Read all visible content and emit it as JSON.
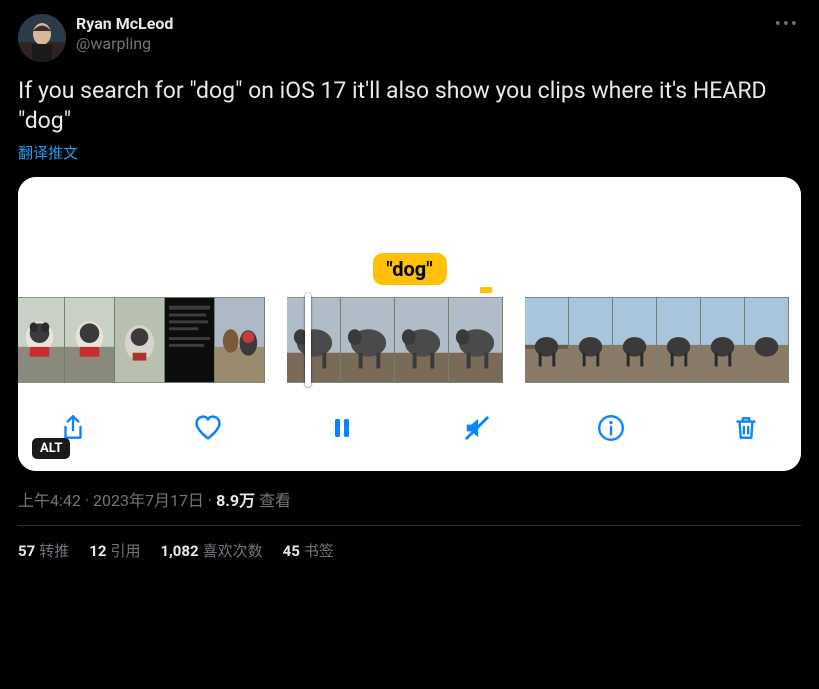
{
  "author": {
    "display_name": "Ryan McLeod",
    "handle": "@warpling"
  },
  "tweet": {
    "text": "If you search for \"dog\" on iOS 17 it'll also show you clips where it's HEARD \"dog\"",
    "translate_label": "翻译推文"
  },
  "media": {
    "search_term": "\"dog\"",
    "alt_badge": "ALT",
    "toolbar": {
      "share": "share",
      "like": "like",
      "pause": "pause",
      "mute": "mute",
      "info": "info",
      "delete": "delete"
    }
  },
  "meta": {
    "time": "上午4:42",
    "date": "2023年7月17日",
    "views_count": "8.9万",
    "views_label": "查看",
    "separator": " · "
  },
  "stats": {
    "retweets_n": "57",
    "retweets_label": "转推",
    "quotes_n": "12",
    "quotes_label": "引用",
    "likes_n": "1,082",
    "likes_label": "喜欢次数",
    "bookmarks_n": "45",
    "bookmarks_label": "书签"
  }
}
